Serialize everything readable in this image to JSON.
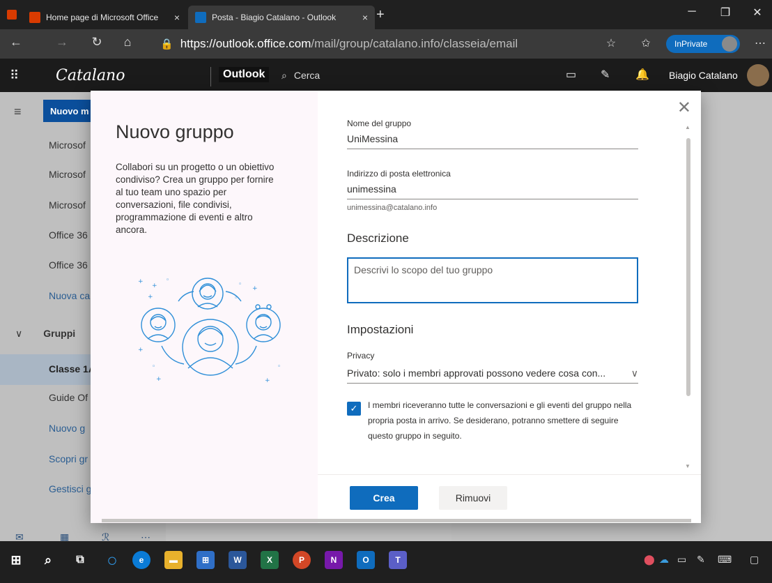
{
  "browser": {
    "tabs": [
      {
        "label": "Home page di Microsoft Office",
        "close": "×",
        "color": "#d83b01"
      },
      {
        "label": "Posta - Biagio Catalano - Outlook",
        "close": "×",
        "color": "#0f6cbd"
      }
    ],
    "new_tab": "+",
    "window_controls": {
      "minimize": "─",
      "restore": "❐",
      "close": "✕"
    },
    "nav": {
      "back": "←",
      "forward": "→",
      "refresh": "↻",
      "home": "⌂"
    },
    "url_host": "https://outlook.office.com",
    "url_path": "/mail/group/catalano.info/classeia/email",
    "lock": "🔒",
    "favorite": "☆",
    "favorites": "✩",
    "inprivate": "InPrivate",
    "more": "⋯"
  },
  "app": {
    "waffle": "⠿",
    "brand": "Catalano",
    "product": "Outlook",
    "search_placeholder": "Cerca",
    "search_icon": "⌕",
    "icons": {
      "teams": "▭",
      "todo": "✎",
      "bell": "🔔"
    },
    "user_name": "Biagio Catalano"
  },
  "sidebar": {
    "hamburger": "≡",
    "new_button": "Nuovo m",
    "items": [
      {
        "label": "Microsof"
      },
      {
        "label": "Microsof"
      },
      {
        "label": "Microsof"
      },
      {
        "label": "Office 36"
      },
      {
        "label": "Office 36"
      },
      {
        "label": "Nuova ca"
      }
    ],
    "groups_chevron": "∨",
    "groups_label": "Gruppi",
    "group_items": [
      {
        "label": "Classe 1A",
        "selected": true
      },
      {
        "label": "Guide Of"
      },
      {
        "label": "Nuovo g"
      },
      {
        "label": "Scopri gr"
      },
      {
        "label": "Gestisci g"
      }
    ],
    "bottom_icons": {
      "mail": "✉",
      "calendar": "▦",
      "people": "ℛ",
      "more": "⋯"
    }
  },
  "dialog": {
    "title": "Nuovo gruppo",
    "description": "Collabori su un progetto o un obiettivo condiviso? Crea un gruppo per fornire al tuo team uno spazio per conversazioni, file condivisi, programmazione di eventi e altro ancora.",
    "close": "✕",
    "group_name_label": "Nome del gruppo",
    "group_name_value": "UniMessina",
    "email_label": "Indirizzo di posta elettronica",
    "email_value": "unimessina",
    "email_hint": "unimessina@catalano.info",
    "description_heading": "Descrizione",
    "description_placeholder": "Descrivi lo scopo del tuo gruppo",
    "settings_heading": "Impostazioni",
    "privacy_label": "Privacy",
    "privacy_value": "Privato: solo i membri approvati possono vedere cosa con...",
    "privacy_chevron": "∨",
    "follow_checked": true,
    "checkmark": "✓",
    "follow_text": "I membri riceveranno tutte le conversazioni e gli eventi del gruppo nella propria posta in arrivo. Se desiderano, potranno smettere di seguire questo gruppo in seguito.",
    "create_button": "Crea",
    "remove_button": "Rimuovi"
  },
  "taskbar": {
    "start": "⊞",
    "search": "⌕",
    "taskview": "⧉",
    "cortana": "○",
    "apps": [
      {
        "name": "edge",
        "label": "e",
        "color": "#0a7bd6"
      },
      {
        "name": "file-explorer",
        "label": "▬",
        "color": "#e8b12c"
      },
      {
        "name": "store",
        "label": "⊞",
        "color": "#2f6fc7"
      },
      {
        "name": "word",
        "label": "W",
        "color": "#2b579a"
      },
      {
        "name": "excel",
        "label": "X",
        "color": "#217346"
      },
      {
        "name": "powerpoint",
        "label": "P",
        "color": "#d24726"
      },
      {
        "name": "onenote",
        "label": "N",
        "color": "#7719aa"
      },
      {
        "name": "outlook",
        "label": "O",
        "color": "#0f6cbd"
      },
      {
        "name": "teams",
        "label": "T",
        "color": "#5b5fc7"
      }
    ],
    "tray": {
      "shield": "⬤",
      "cloud": "☁",
      "network": "▭",
      "pen": "✎",
      "keyboard": "⌨",
      "notifications": "▢"
    }
  }
}
